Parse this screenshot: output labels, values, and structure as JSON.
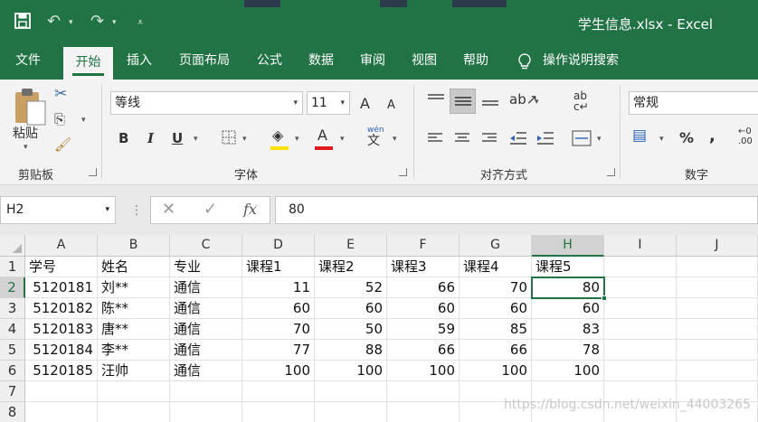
{
  "window": {
    "title": "学生信息.xlsx  -  Excel"
  },
  "tabs": [
    "文件",
    "开始",
    "插入",
    "页面布局",
    "公式",
    "数据",
    "审阅",
    "视图",
    "帮助"
  ],
  "tell_me": "操作说明搜索",
  "ribbon": {
    "clipboard": {
      "paste": "粘贴",
      "label": "剪贴板"
    },
    "font": {
      "name": "等线",
      "size": "11",
      "label": "字体",
      "grow": "A",
      "shrink": "A",
      "bold": "B",
      "italic": "I",
      "underline": "U",
      "wen": "wén",
      "wen_char": "文"
    },
    "alignment": {
      "label": "对齐方式"
    },
    "number": {
      "format": "常规",
      "label": "数字",
      "percent": "%",
      "comma": ","
    }
  },
  "formula_bar": {
    "name_box": "H2",
    "fx": "fx",
    "value": "80"
  },
  "sheet": {
    "columns": [
      "A",
      "B",
      "C",
      "D",
      "E",
      "F",
      "G",
      "H",
      "I",
      "J"
    ],
    "rows": [
      "1",
      "2",
      "3",
      "4",
      "5",
      "6",
      "7",
      "8"
    ],
    "header": [
      "学号",
      "姓名",
      "专业",
      "课程1",
      "课程2",
      "课程3",
      "课程4",
      "课程5"
    ],
    "data": [
      [
        "5120181",
        "刘**",
        "通信",
        "11",
        "52",
        "66",
        "70",
        "80"
      ],
      [
        "5120182",
        "陈**",
        "通信",
        "60",
        "60",
        "60",
        "60",
        "60"
      ],
      [
        "5120183",
        "唐**",
        "通信",
        "70",
        "50",
        "59",
        "85",
        "83"
      ],
      [
        "5120184",
        "李**",
        "通信",
        "77",
        "88",
        "66",
        "66",
        "78"
      ],
      [
        "5120185",
        "汪帅",
        "通信",
        "100",
        "100",
        "100",
        "100",
        "100"
      ]
    ],
    "selected_cell": "H2"
  },
  "watermark": "https://blog.csdn.net/weixin_44003265",
  "colors": {
    "accent": "#217346"
  }
}
